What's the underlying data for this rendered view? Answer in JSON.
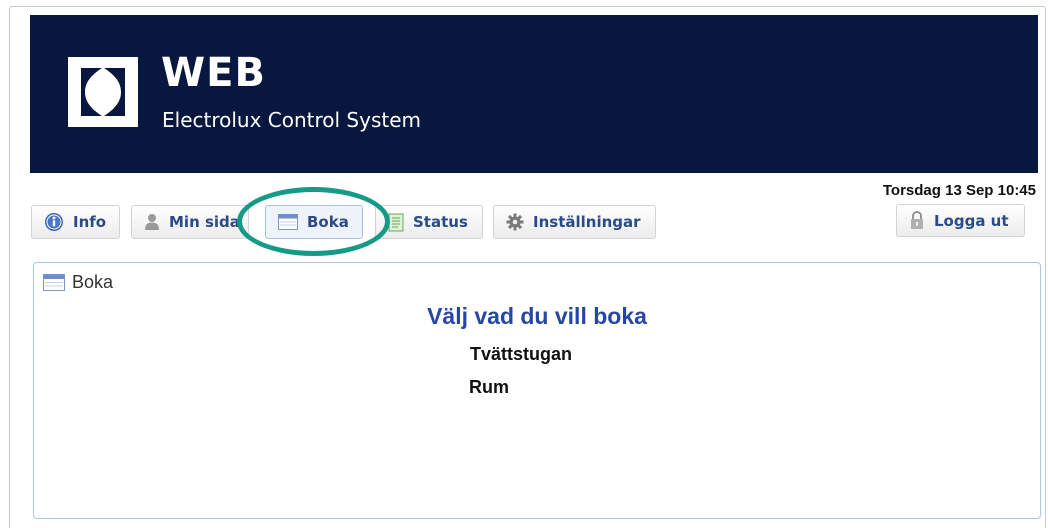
{
  "brand": {
    "title": "WEB",
    "subtitle": "Electrolux Control System",
    "background_color": "#08173f"
  },
  "datetime": "Torsdag 13 Sep 10:45",
  "nav": {
    "info": "Info",
    "min_sida": "Min sida",
    "boka": "Boka",
    "status": "Status",
    "installningar": "Inställningar",
    "logout": "Logga ut",
    "active": "boka",
    "highlight_color": "#159a88"
  },
  "panel": {
    "header": "Boka",
    "title": "Välj vad du vill boka",
    "options": [
      "Tvättstugan",
      "Rum"
    ],
    "title_color": "#2548a6"
  },
  "icons": {
    "info": "info-circle-icon",
    "user": "user-icon",
    "calendar": "calendar-icon",
    "status": "document-icon",
    "settings": "gear-icon",
    "logout": "padlock-icon"
  }
}
